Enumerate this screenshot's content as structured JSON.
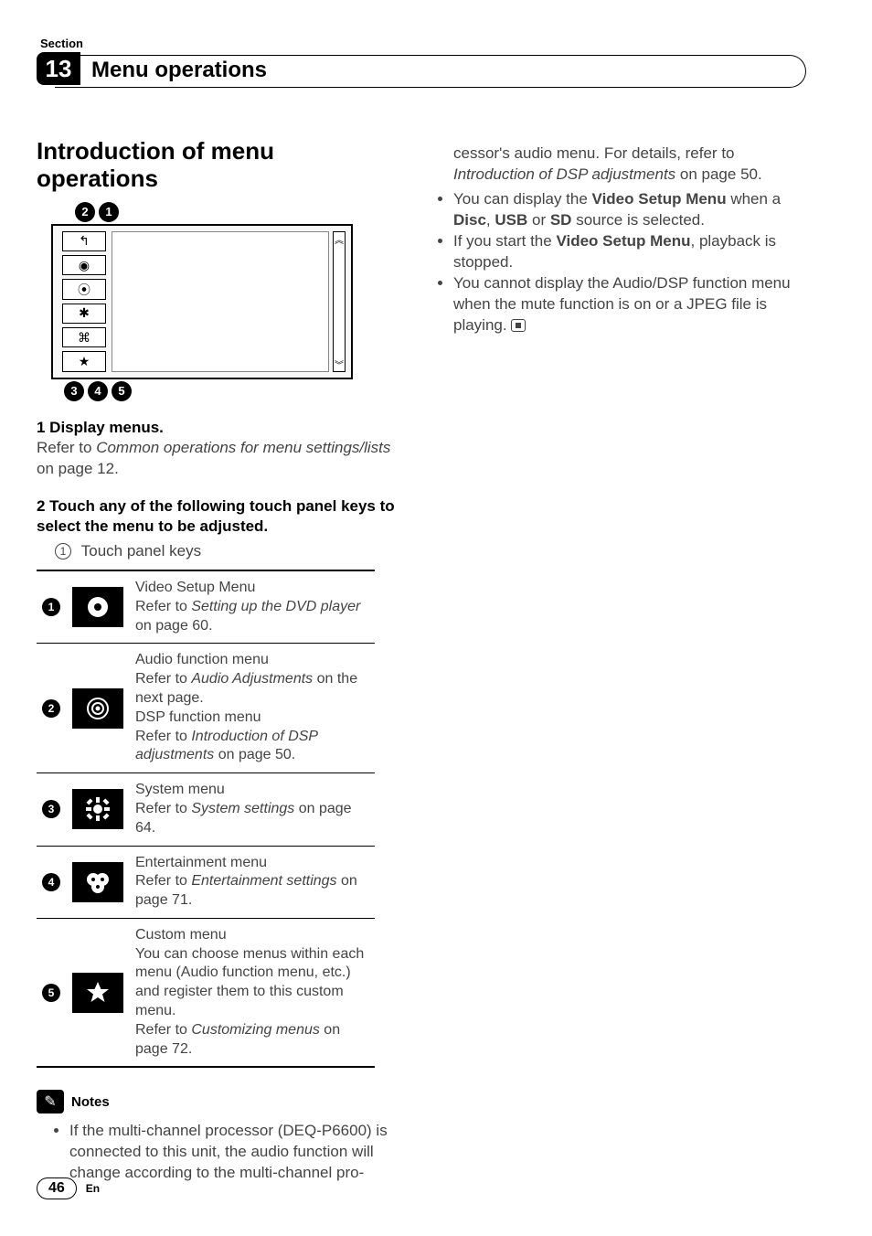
{
  "header": {
    "section_label": "Section",
    "section_number": "13",
    "title": "Menu operations"
  },
  "left": {
    "h1": "Introduction of menu operations",
    "fig": {
      "top_callouts": [
        "2",
        "1"
      ],
      "bot_callouts": [
        "3",
        "4",
        "5"
      ],
      "sidebar_glyphs": [
        "↰",
        "◉",
        "⦿",
        "✱",
        "⌘",
        "★"
      ],
      "scroll_top": "︽",
      "scroll_bot": "︾"
    },
    "step1": {
      "label": "1   Display menus.",
      "text_a": "Refer to ",
      "ref": "Common operations for menu settings/lists",
      "text_b": " on page 12."
    },
    "step2": {
      "label": "2   Touch any of the following touch panel keys to select the menu to be adjusted.",
      "sub_num": "1",
      "sub_text": "Touch panel keys"
    },
    "table": [
      {
        "n": "1",
        "glyph": "disc",
        "title": "Video Setup Menu",
        "ref_pre": "Refer to ",
        "ref": "Setting up the DVD player",
        "ref_post": " on page 60."
      },
      {
        "n": "2",
        "glyph": "ring",
        "title": "Audio function menu",
        "ref_pre": "Refer to ",
        "ref": "Audio Adjustments",
        "ref_post": " on the next page.",
        "title2": "DSP function menu",
        "ref2_pre": "Refer to ",
        "ref2": "Introduction of DSP adjustments",
        "ref2_post": " on page 50."
      },
      {
        "n": "3",
        "glyph": "gear",
        "title": "System menu",
        "ref_pre": "Refer to ",
        "ref": "System settings",
        "ref_post": " on page 64."
      },
      {
        "n": "4",
        "glyph": "ent",
        "title": "Entertainment menu",
        "ref_pre": "Refer to ",
        "ref": "Entertainment settings",
        "ref_post": " on page 71."
      },
      {
        "n": "5",
        "glyph": "star",
        "title": "Custom menu",
        "body": "You can choose menus within each menu (Audio function menu, etc.) and register them to this custom menu.",
        "ref_pre": "Refer to ",
        "ref": "Customizing menus",
        "ref_post": " on page 72."
      }
    ],
    "notes_label": "Notes",
    "note1": "If the multi-channel processor (DEQ-P6600) is connected to this unit, the audio function will change according to the multi-channel pro-"
  },
  "right": {
    "cont_a": "cessor's audio menu. For details, refer to ",
    "cont_ref": "Introduction of DSP adjustments",
    "cont_b": " on page 50.",
    "bullets": [
      {
        "pre": "You can display the ",
        "b1": "Video Setup Menu",
        "mid": " when a ",
        "b2": "Disc",
        "mid2": ", ",
        "b3": "USB",
        "mid3": " or ",
        "b4": "SD",
        "post": " source is selected."
      },
      {
        "pre": "If you start the ",
        "b1": "Video Setup Menu",
        "post": ", playback is stopped."
      },
      {
        "plain": "You cannot display the Audio/DSP function menu when the mute function is on or a JPEG file is playing.",
        "end": true
      }
    ]
  },
  "footer": {
    "page": "46",
    "lang": "En"
  }
}
